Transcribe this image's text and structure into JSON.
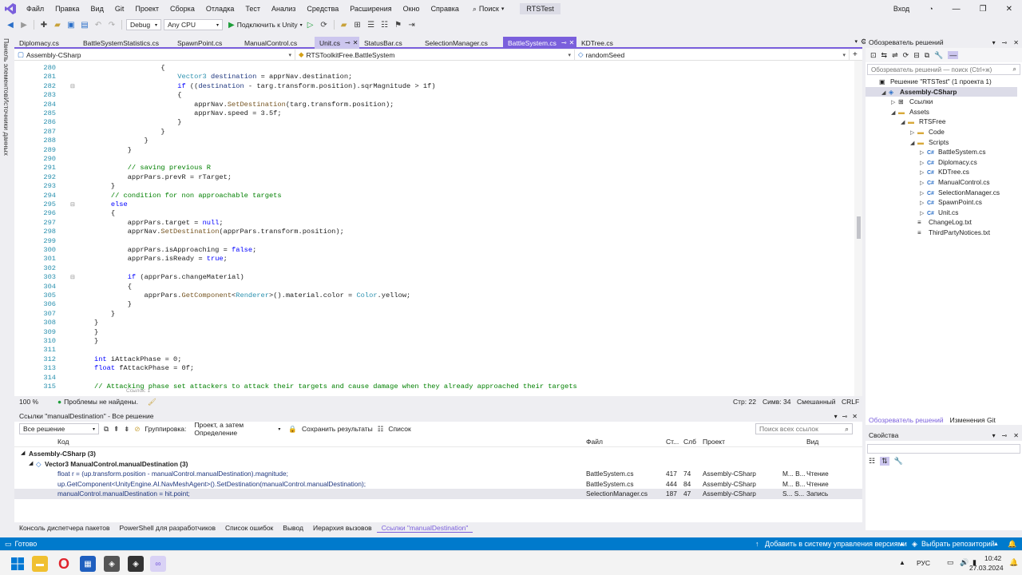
{
  "menubar": {
    "items": [
      "Файл",
      "Правка",
      "Вид",
      "Git",
      "Проект",
      "Сборка",
      "Отладка",
      "Тест",
      "Анализ",
      "Средства",
      "Расширения",
      "Окно",
      "Справка"
    ],
    "search_label": "Поиск",
    "project_name": "RTSTest",
    "signin": "Вход"
  },
  "toolbar": {
    "config": "Debug",
    "platform": "Any CPU",
    "run_label": "Подключить к Unity"
  },
  "left_strip": {
    "toolbox": "Панель элементов",
    "datasources": "Источники данных"
  },
  "tabs": [
    {
      "label": "Diplomacy.cs"
    },
    {
      "label": "BattleSystemStatistics.cs"
    },
    {
      "label": "SpawnPoint.cs"
    },
    {
      "label": "ManualControl.cs"
    },
    {
      "label": "Unit.cs"
    },
    {
      "label": "StatusBar.cs"
    },
    {
      "label": "SelectionManager.cs"
    },
    {
      "label": "BattleSystem.cs"
    },
    {
      "label": "KDTree.cs"
    }
  ],
  "navbar": {
    "project": "Assembly-CSharp",
    "type": "RTSToolkitFree.BattleSystem",
    "member": "randomSeed"
  },
  "code_lines": [
    {
      "n": "280",
      "html": "                {"
    },
    {
      "n": "281",
      "html": "                    <span class=\"ty\">Vector3</span> <span class=\"fd\">destination</span> = apprNav.destination;"
    },
    {
      "n": "282",
      "html": "                    <span class=\"kw\">if</span> ((<span class=\"fd\">destination</span> - targ.transform.position).sqrMagnitude &gt; 1f)"
    },
    {
      "n": "283",
      "html": "                    {"
    },
    {
      "n": "284",
      "html": "                        apprNav.<span class=\"mb\">SetDestination</span>(targ.transform.position);"
    },
    {
      "n": "285",
      "html": "                        apprNav.speed = 3.5f;"
    },
    {
      "n": "286",
      "html": "                    }"
    },
    {
      "n": "287",
      "html": "                }"
    },
    {
      "n": "288",
      "html": "            }"
    },
    {
      "n": "289",
      "html": "        }"
    },
    {
      "n": "290",
      "html": ""
    },
    {
      "n": "291",
      "html": "        <span class=\"cm\">// saving previous R</span>"
    },
    {
      "n": "292",
      "html": "        apprPars.prevR = rTarget;"
    },
    {
      "n": "293",
      "html": "    }"
    },
    {
      "n": "294",
      "html": "    <span class=\"cm\">// condition for non approachable targets</span>"
    },
    {
      "n": "295",
      "html": "    <span class=\"kw\">else</span>"
    },
    {
      "n": "296",
      "html": "    {"
    },
    {
      "n": "297",
      "html": "        apprPars.target = <span class=\"kw\">null</span>;"
    },
    {
      "n": "298",
      "html": "        apprNav.<span class=\"mb\">SetDestination</span>(apprPars.transform.position);"
    },
    {
      "n": "299",
      "html": ""
    },
    {
      "n": "300",
      "html": "        apprPars.isApproaching = <span class=\"kw\">false</span>;"
    },
    {
      "n": "301",
      "html": "        apprPars.isReady = <span class=\"kw\">true</span>;"
    },
    {
      "n": "302",
      "html": ""
    },
    {
      "n": "303",
      "html": "        <span class=\"kw\">if</span> (apprPars.changeMaterial)"
    },
    {
      "n": "304",
      "html": "        {"
    },
    {
      "n": "305",
      "html": "            apprPars.<span class=\"mb\">GetComponent</span>&lt;<span class=\"ty\">Renderer</span>&gt;().material.color = <span class=\"ty\">Color</span>.yellow;"
    },
    {
      "n": "306",
      "html": "        }"
    },
    {
      "n": "307",
      "html": "    }"
    },
    {
      "n": "308",
      "html": "}"
    },
    {
      "n": "309",
      "html": "}"
    },
    {
      "n": "310",
      "html": "}"
    },
    {
      "n": "311",
      "html": ""
    },
    {
      "n": "312",
      "html": "<span class=\"kw\">int</span> iAttackPhase = 0;"
    },
    {
      "n": "313",
      "html": "<span class=\"kw\">float</span> fAttackPhase = 0f;"
    },
    {
      "n": "314",
      "html": ""
    },
    {
      "n": "315",
      "html": "<span class=\"cm\">// Attacking phase set attackers to attack their targets and cause damage when they already approached their targets</span>"
    }
  ],
  "code_ghost": "Ссылок: 1",
  "editor_status": {
    "zoom": "100 %",
    "problems": "Проблемы не найдены.",
    "line": "Стр: 22",
    "col": "Симв: 34",
    "mixed": "Смешанный",
    "eol": "CRLF"
  },
  "refs": {
    "title": "Ссылки \"manualDestination\" - Все решение",
    "scope": "Все решение",
    "grouping_label": "Группировка:",
    "grouping_value": "Проект, а затем Определение",
    "keep_results": "Сохранить результаты",
    "list": "Список",
    "search_placeholder": "Поиск всех ссылок",
    "col_code": "Код",
    "col_file": "Файл",
    "col_line": "Ст...",
    "col_char": "Слб",
    "col_project": "Проект",
    "col_kind": "Вид",
    "group_project": "Assembly-CSharp (3)",
    "group_def": "Vector3 ManualControl.manualDestination (3)",
    "rows": [
      {
        "code": "float r = (up.transform.position - manualControl.manualDestination).magnitude;",
        "file": "BattleSystem.cs",
        "line": "417",
        "col": "74",
        "project": "Assembly-CSharp",
        "extra": "M... B...",
        "kind": "Чтение"
      },
      {
        "code": "up.GetComponent<UnityEngine.AI.NavMeshAgent>().SetDestination(manualControl.manualDestination);",
        "file": "BattleSystem.cs",
        "line": "444",
        "col": "84",
        "project": "Assembly-CSharp",
        "extra": "M... B...",
        "kind": "Чтение"
      },
      {
        "code": "manualControl.manualDestination = hit.point;",
        "file": "SelectionManager.cs",
        "line": "187",
        "col": "47",
        "project": "Assembly-CSharp",
        "extra": "S... S...",
        "kind": "Запись"
      }
    ]
  },
  "bottom_tabs": [
    "Консоль диспетчера пакетов",
    "PowerShell для разработчиков",
    "Список ошибок",
    "Вывод",
    "Иерархия вызовов",
    "Ссылки \"manualDestination\""
  ],
  "statusbar": {
    "ready": "Готово",
    "add_source": "Добавить в систему управления версиями",
    "repo": "Выбрать репозиторий"
  },
  "solution_explorer": {
    "title": "Обозреватель решений",
    "search_placeholder": "Обозреватель решений — поиск (Ctrl+ж)",
    "tree": [
      {
        "label": "Решение \"RTSTest\" (1 проекта 1)",
        "level": 0,
        "icon": "▣",
        "exp": ""
      },
      {
        "label": "Assembly-CSharp",
        "level": 1,
        "icon": "◈",
        "exp": "◢",
        "bold": true
      },
      {
        "label": "Ссылки",
        "level": 2,
        "icon": "⊞",
        "exp": "▷"
      },
      {
        "label": "Assets",
        "level": 2,
        "icon": "▬",
        "exp": "◢"
      },
      {
        "label": "RTSFree",
        "level": 3,
        "icon": "▬",
        "exp": "◢"
      },
      {
        "label": "Code",
        "level": 4,
        "icon": "▬",
        "exp": "▷"
      },
      {
        "label": "Scripts",
        "level": 4,
        "icon": "▬",
        "exp": "◢"
      },
      {
        "label": "BattleSystem.cs",
        "level": 5,
        "icon": "C#",
        "exp": "▷"
      },
      {
        "label": "Diplomacy.cs",
        "level": 5,
        "icon": "C#",
        "exp": "▷"
      },
      {
        "label": "KDTree.cs",
        "level": 5,
        "icon": "C#",
        "exp": "▷"
      },
      {
        "label": "ManualControl.cs",
        "level": 5,
        "icon": "C#",
        "exp": "▷"
      },
      {
        "label": "SelectionManager.cs",
        "level": 5,
        "icon": "C#",
        "exp": "▷"
      },
      {
        "label": "SpawnPoint.cs",
        "level": 5,
        "icon": "C#",
        "exp": "▷"
      },
      {
        "label": "Unit.cs",
        "level": 5,
        "icon": "C#",
        "exp": "▷"
      },
      {
        "label": "ChangeLog.txt",
        "level": 4,
        "icon": "≡",
        "exp": ""
      },
      {
        "label": "ThirdPartyNotices.txt",
        "level": 4,
        "icon": "≡",
        "exp": ""
      }
    ],
    "tab_se": "Обозреватель решений",
    "tab_git": "Изменения Git"
  },
  "properties": {
    "title": "Свойства"
  },
  "taskbar": {
    "lang": "РУС",
    "time": "10:42",
    "date": "27.03.2024"
  },
  "colors": {
    "accent": "#7a5fdc",
    "statusbar": "#007acc"
  }
}
